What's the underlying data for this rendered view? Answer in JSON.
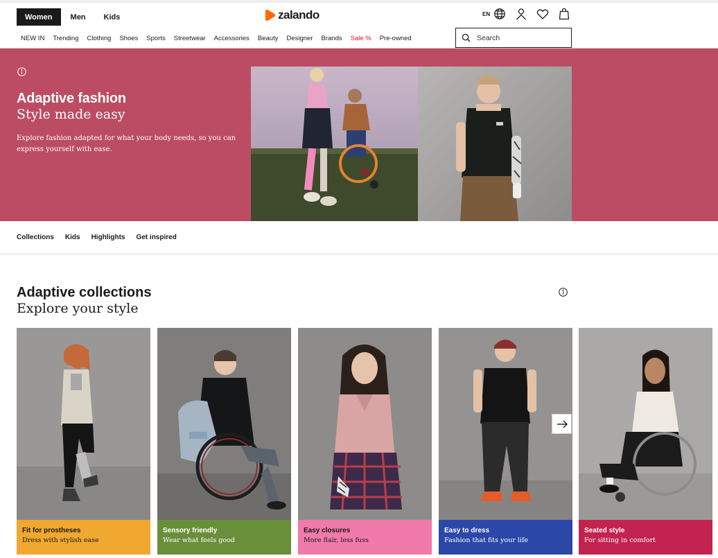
{
  "header": {
    "gender_tabs": [
      "Women",
      "Men",
      "Kids"
    ],
    "active_tab": "Women",
    "logo": "zalando",
    "language": "EN",
    "icons": [
      "globe-icon",
      "account-icon",
      "wishlist-heart-icon",
      "bag-icon"
    ],
    "categories": [
      "NEW IN",
      "Trending",
      "Clothing",
      "Shoes",
      "Sports",
      "Streetwear",
      "Accessories",
      "Beauty",
      "Designer",
      "Brands",
      "Sale %",
      "Pre-owned"
    ],
    "search": {
      "placeholder": "Search",
      "value": ""
    }
  },
  "hero": {
    "title": "Adaptive fashion",
    "subtitle": "Style made easy",
    "description": "Explore fashion adapted for what your body needs, so you can express yourself with ease.",
    "background_color": "#bc4c63"
  },
  "subnav": [
    "Collections",
    "Kids",
    "Highlights",
    "Get inspired"
  ],
  "collections": {
    "title": "Adaptive collections",
    "subtitle": "Explore your style",
    "cards": [
      {
        "title": "Fit for prostheses",
        "subtitle": "Dress with stylish ease",
        "color": "#f0a830",
        "text_color": "#1a1a1a"
      },
      {
        "title": "Sensory friendly",
        "subtitle": "Wear what feels good",
        "color": "#6a8f3a",
        "text_color": "#ffffff"
      },
      {
        "title": "Easy closures",
        "subtitle": "More flair, less fuss",
        "color": "#f07aa9",
        "text_color": "#1a1a1a"
      },
      {
        "title": "Easy to dress",
        "subtitle": "Fashion that fits your life",
        "color": "#2b48a8",
        "text_color": "#ffffff"
      },
      {
        "title": "Seated style",
        "subtitle": "For sitting in comfort",
        "color": "#c2234f",
        "text_color": "#ffffff"
      }
    ]
  },
  "colors": {
    "brand_orange": "#ff6900",
    "sale_red": "#e0102c"
  }
}
